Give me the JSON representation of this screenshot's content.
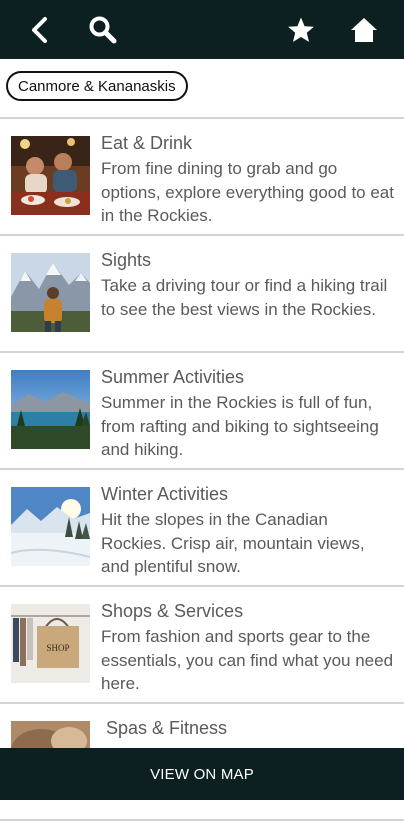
{
  "toolbar": {
    "back_icon": "chevron-left-icon",
    "search_icon": "search-icon",
    "favorites_icon": "star-icon",
    "home_icon": "home-icon",
    "background_color": "#0c2021"
  },
  "filter": {
    "chip_label": "Canmore & Kananaskis"
  },
  "categories": [
    {
      "title": "Eat & Drink",
      "description": "From fine dining to grab and go options, explore everything good to eat in the Rockies."
    },
    {
      "title": "Sights",
      "description": "Take a driving tour or find a hiking trail to see the best views in the Rockies."
    },
    {
      "title": "Summer Activities",
      "description": "Summer in the Rockies is full of fun, from rafting and biking to sightseeing and hiking."
    },
    {
      "title": "Winter Activities",
      "description": "Hit the slopes in the Canadian Rockies. Crisp air, mountain views, and plentiful snow."
    },
    {
      "title": "Shops & Services",
      "description": "From fashion and sports gear to the essentials, you can find what you need here."
    },
    {
      "title": " Spas & Fitness",
      "description": ""
    }
  ],
  "thumbnail_texts": {
    "shop_bag": "SHOP"
  },
  "footer": {
    "map_button_label": "VIEW ON MAP"
  }
}
